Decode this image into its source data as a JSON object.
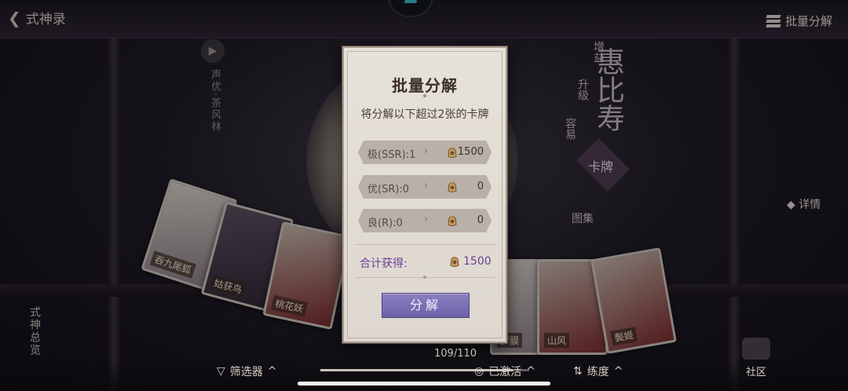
{
  "header": {
    "back_label": "式神录",
    "bulk_label": "批量分解"
  },
  "side_left": {
    "cv_label": "声优·茶风林",
    "book_label": "式神总览"
  },
  "side_right": {
    "v1": "增益",
    "v2": "升级",
    "v3": "容易",
    "big_name": "惠比寿",
    "card_tab": "卡牌",
    "atlas_tab": "图集",
    "detail_label": "详情",
    "community_label": "社区"
  },
  "cards_left": [
    {
      "label": "吞九尾狐"
    },
    {
      "label": "姑获鸟"
    },
    {
      "label": "桃花妖"
    }
  ],
  "cards_right": [
    {
      "label": "梦貘"
    },
    {
      "label": "山风"
    },
    {
      "label": "鬓姬"
    }
  ],
  "footer": {
    "filter_label": "筛选器",
    "activated_label": "已激活",
    "sort_label": "练度",
    "counter": "109/110",
    "scroll_progress": 0.92
  },
  "modal": {
    "title": "批量分解",
    "subtitle": "将分解以下超过2张的卡牌",
    "rows": [
      {
        "label": "极(SSR):1",
        "value": "1500"
      },
      {
        "label": "优(SR):0",
        "value": "0"
      },
      {
        "label": "良(R):0",
        "value": "0"
      }
    ],
    "total_label": "合计获得:",
    "total_value": "1500",
    "button_label": "分解"
  },
  "colors": {
    "modal_bg": "#e2ddd5",
    "row_bg": "#b9b0a8",
    "total_text": "#6a3f92",
    "button": "#7d72b4"
  }
}
